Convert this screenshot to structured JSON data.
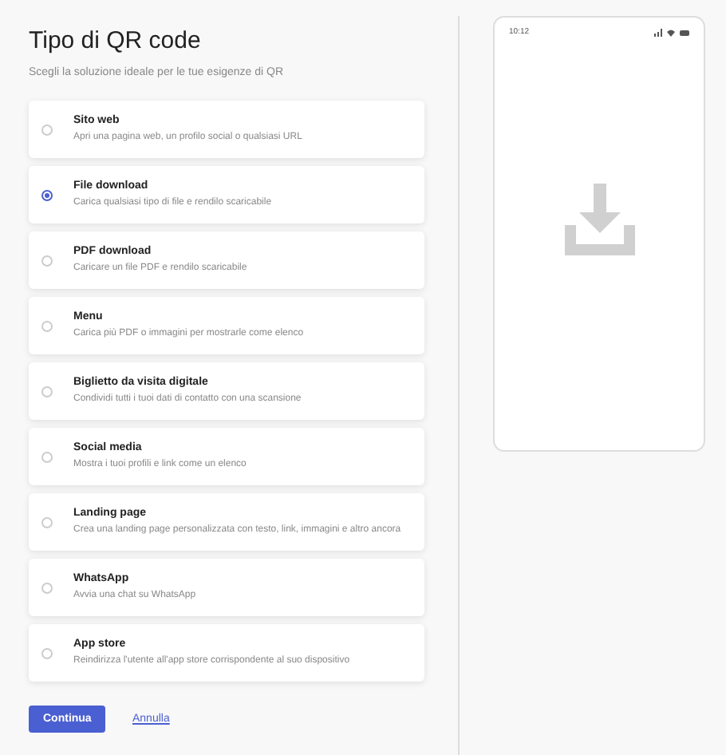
{
  "title": "Tipo di QR code",
  "subtitle": "Scegli la soluzione ideale per le tue esigenze di QR",
  "options": [
    {
      "label": "Sito web",
      "description": "Apri una pagina web, un profilo social o qualsiasi URL",
      "selected": false
    },
    {
      "label": "File download",
      "description": "Carica qualsiasi tipo di file e rendilo scaricabile",
      "selected": true
    },
    {
      "label": "PDF download",
      "description": "Caricare un file PDF e rendilo scaricabile",
      "selected": false
    },
    {
      "label": "Menu",
      "description": "Carica più PDF o immagini per mostrarle come elenco",
      "selected": false
    },
    {
      "label": "Biglietto da visita digitale",
      "description": "Condividi tutti i tuoi dati di contatto con una scansione",
      "selected": false
    },
    {
      "label": "Social media",
      "description": "Mostra i tuoi profili e link come un elenco",
      "selected": false
    },
    {
      "label": "Landing page",
      "description": "Crea una landing page personalizzata con testo, link, immagini e altro ancora",
      "selected": false
    },
    {
      "label": "WhatsApp",
      "description": "Avvia una chat su WhatsApp",
      "selected": false
    },
    {
      "label": "App store",
      "description": "Reindirizza l'utente all'app store corrispondente al suo dispositivo",
      "selected": false
    }
  ],
  "buttons": {
    "primary": "Continua",
    "secondary": "Annulla"
  },
  "phone": {
    "time": "10:12"
  }
}
